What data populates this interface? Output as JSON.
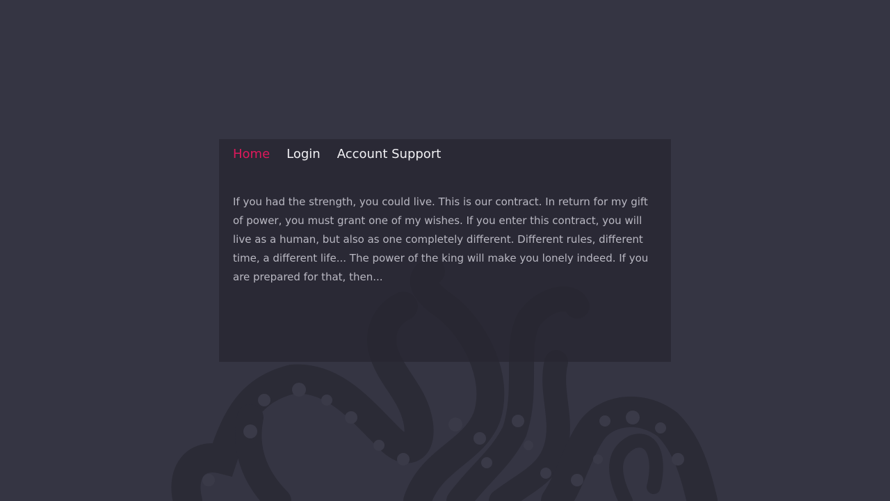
{
  "nav": {
    "items": [
      {
        "label": "Home",
        "active": true
      },
      {
        "label": "Login",
        "active": false
      },
      {
        "label": "Account Support",
        "active": false
      }
    ]
  },
  "main": {
    "text": "If you had the strength, you could live. This is our contract. In return for my gift of power, you must grant one of my wishes. If you enter this contract, you will live as a human, but also as one completely different. Different rules, different time, a different life... The power of the king will make you lonely indeed. If you are prepared for that, then..."
  },
  "colors": {
    "background": "#353543",
    "panel": "#2a2935",
    "accent": "#e0185c",
    "nav_text": "#f1f1f4",
    "body_text": "#b9b8c2",
    "art": "#2a2a35"
  },
  "icons": {
    "background_art": "octopus-tentacles-icon"
  }
}
